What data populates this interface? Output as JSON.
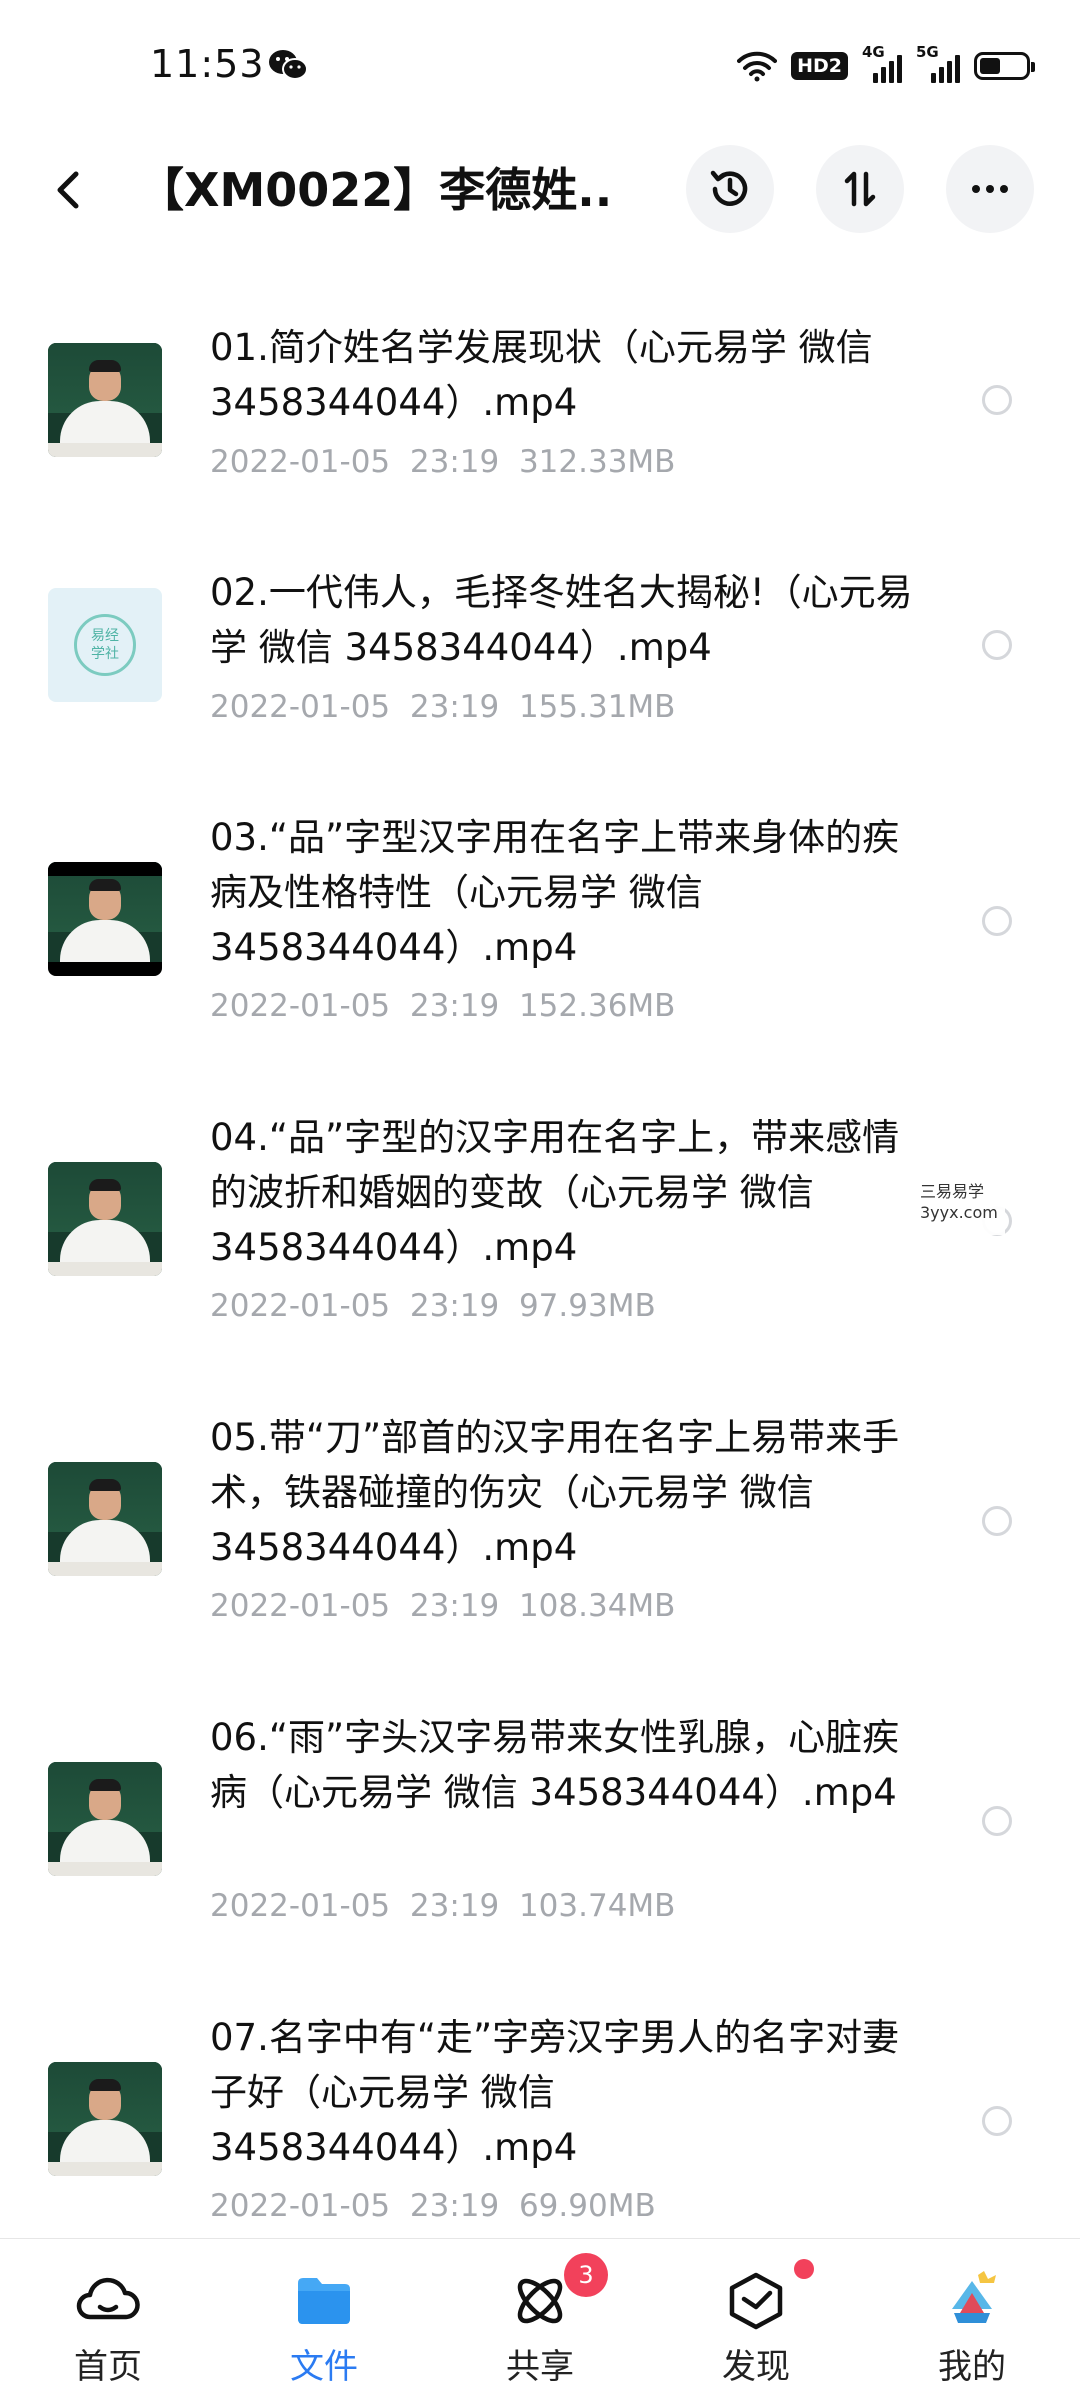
{
  "status_bar": {
    "time": "11:53",
    "hd_badge": "HD2",
    "signal_1": "4G",
    "signal_2": "5G",
    "battery_level": 0.45,
    "icons": [
      "wechat-icon",
      "wifi-icon",
      "signal-icon",
      "battery-icon"
    ]
  },
  "header": {
    "title": "【XM0022】李德姓...",
    "icons": [
      "back-arrow-icon",
      "history-icon",
      "sort-icon",
      "more-icon"
    ]
  },
  "files": [
    {
      "name": "01.简介姓名学发展现状（心元易学 微信 3458344044）.mp4",
      "date": "2022-01-05",
      "time": "23:19",
      "size": "312.33MB",
      "thumb": "video"
    },
    {
      "name": "02.一代伟人，毛择冬姓名大揭秘!（心元易学 微信 3458344044）.mp4",
      "date": "2022-01-05",
      "time": "23:19",
      "size": "155.31MB",
      "thumb": "logo",
      "logo_text_1": "易经",
      "logo_text_2": "学社"
    },
    {
      "name": "03.“品”字型汉字用在名字上带来身体的疾病及性格特性（心元易学 微信 3458344044）.mp4",
      "date": "2022-01-05",
      "time": "23:19",
      "size": "152.36MB",
      "thumb": "letterbox"
    },
    {
      "name": "04.“品”字型的汉字用在名字上，带来感情的波折和婚姻的变故（心元易学 微信 3458344044）.mp4",
      "date": "2022-01-05",
      "time": "23:19",
      "size": "97.93MB",
      "thumb": "video"
    },
    {
      "name": "05.带“刀”部首的汉字用在名字上易带来手术，铁器碰撞的伤灾（心元易学 微信 3458344044）.mp4",
      "date": "2022-01-05",
      "time": "23:19",
      "size": "108.34MB",
      "thumb": "video"
    },
    {
      "name": "06.“雨”字头汉字易带来女性乳腺，心脏疾病（心元易学 微信 3458344044）.mp4",
      "date": "2022-01-05",
      "time": "23:19",
      "size": "103.74MB",
      "thumb": "video"
    },
    {
      "name": "07.名字中有“走”字旁汉字男人的名字对妻子好（心元易学 微信 3458344044）.mp4",
      "date": "2022-01-05",
      "time": "23:19",
      "size": "69.90MB",
      "thumb": "video"
    }
  ],
  "watermark": {
    "line1": "三易易学",
    "line2": "3yyx.com"
  },
  "bottom_nav": [
    {
      "label": "首页",
      "icon": "home-cloud-icon",
      "active": false
    },
    {
      "label": "文件",
      "icon": "folder-icon",
      "active": true
    },
    {
      "label": "共享",
      "icon": "share-atom-icon",
      "active": false,
      "badge": "3"
    },
    {
      "label": "发现",
      "icon": "discover-box-icon",
      "active": false,
      "dot": true
    },
    {
      "label": "我的",
      "icon": "profile-avatar-icon",
      "active": false
    }
  ],
  "colors": {
    "accent": "#2b7bf2",
    "meta_text": "#a5a8ad",
    "badge": "#f2415b"
  }
}
